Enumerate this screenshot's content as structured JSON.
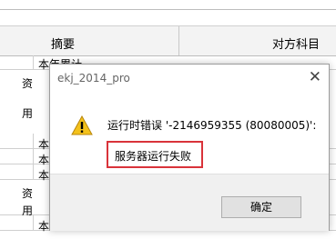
{
  "sheet": {
    "header": {
      "col_summary": "摘要",
      "col_account": "对方科目"
    },
    "rows": [
      {
        "label": "本年累计",
        "side": "资"
      },
      {
        "label": "",
        "side": "用"
      },
      {
        "label": "本",
        "side": ""
      },
      {
        "label": "本",
        "side": ""
      },
      {
        "label": "本",
        "side": "资"
      },
      {
        "label": "",
        "side": "用"
      },
      {
        "label": "本",
        "side": ""
      }
    ]
  },
  "dialog": {
    "title": "ekj_2014_pro",
    "close_glyph": "✕",
    "icon": "warning-icon",
    "message_line1": "运行时错误 '-2146959355 (80080005)':",
    "message_line2": "服务器运行失败",
    "highlight_color": "#d9333a",
    "ok_label": "确定"
  }
}
